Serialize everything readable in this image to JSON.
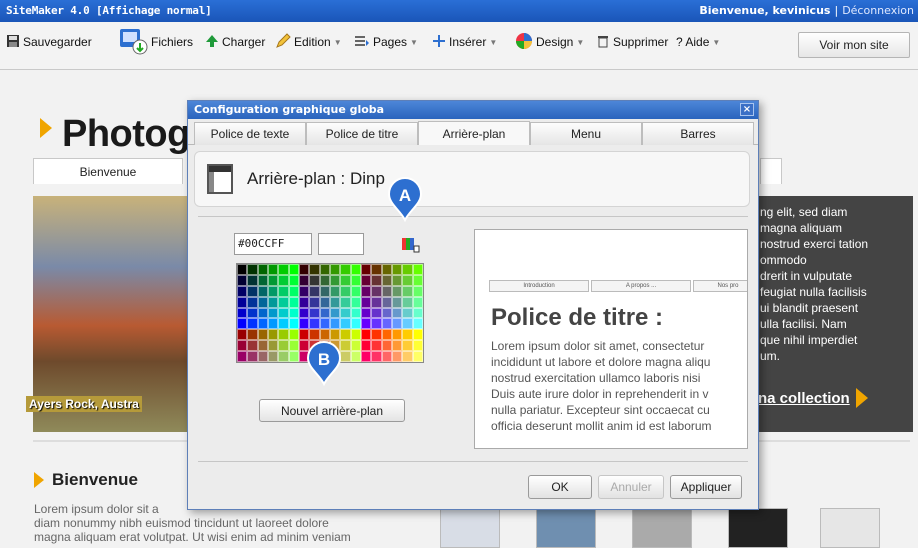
{
  "app": {
    "title": "SiteMaker 4.0",
    "mode": "[Affichage normal]",
    "welcome": "Bienvenue, kevinicus",
    "separator": "|",
    "logout": "Déconnexion"
  },
  "toolbar": {
    "save": "Sauvegarder",
    "files": "Fichiers",
    "load": "Charger",
    "edit": "Edition",
    "pages": "Pages",
    "insert": "Insérer",
    "design": "Design",
    "delete": "Supprimer",
    "help": "? Aide",
    "view_site": "Voir mon site"
  },
  "site": {
    "title": "Photogr",
    "nav_first": "Bienvenue",
    "hero_caption": "Ayers Rock, Austra",
    "hero_text": [
      "ng elit, sed diam",
      "magna aliquam",
      "nostrud exerci tation",
      "ommodo",
      "drerit in vulputate",
      "feugiat nulla facilisis",
      "ui blandit praesent",
      "ulla facilisi. Nam",
      "que nihil imperdiet",
      "um."
    ],
    "collection_link": "na collection",
    "section_title": "Bienvenue",
    "section_text": [
      "Lorem ipsum dolor sit a",
      "diam nonummy nibh euismod tincidunt ut laoreet dolore",
      "magna aliquam erat volutpat. Ut wisi enim ad minim veniam"
    ]
  },
  "dialog": {
    "title": "Configuration graphique globa",
    "close": "×",
    "tabs": [
      "Police de texte",
      "Police de titre",
      "Arrière-plan",
      "Menu",
      "Barres"
    ],
    "active_tab": "Arrière-plan",
    "header": "Arrière-plan : Dinp",
    "color_value": "#00CCFF",
    "new_background_button": "Nouvel arrière-plan",
    "preview": {
      "tabs": [
        "Introduction",
        "A propos ...",
        "Nos pro"
      ],
      "title": "Police de titre :",
      "text": "Lorem ipsum dolor sit amet, consectetur\nincididunt ut labore et dolore magna aliqu\nnostrud exercitation ullamco laboris nisi\nDuis aute irure dolor in reprehenderit in v\nnulla pariatur. Excepteur sint occaecat cu\nofficia deserunt mollit anim id est laborum"
    },
    "ok": "OK",
    "cancel": "Annuler",
    "apply": "Appliquer"
  },
  "markers": {
    "a": "A",
    "b": "B"
  },
  "colors": {
    "titlebar": "#1f5cbf",
    "accent": "#f0a500",
    "marker": "#2d6fd0"
  }
}
